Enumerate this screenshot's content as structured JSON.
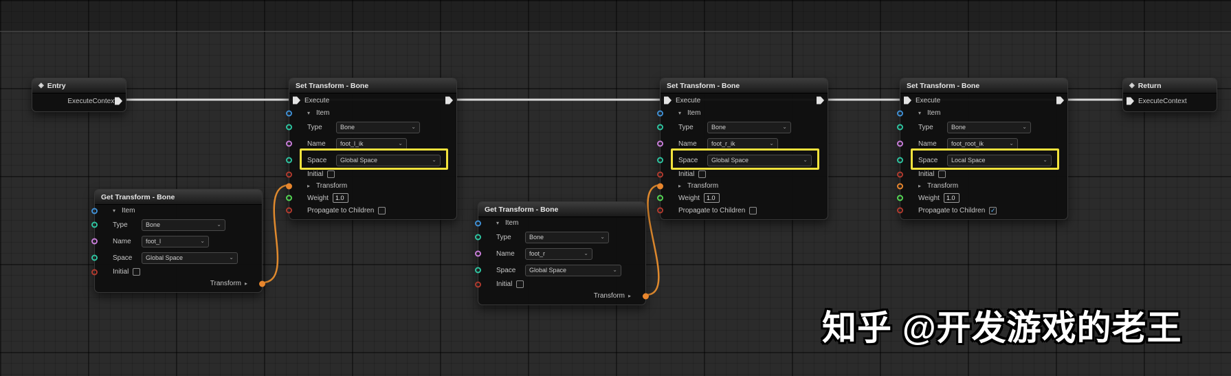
{
  "icons": {
    "diamond": "◈",
    "chevron": "⌄",
    "expander_open": "▾",
    "expander_closed": "▸"
  },
  "labels": {
    "execute": "Execute",
    "item": "Item",
    "type": "Type",
    "name": "Name",
    "space": "Space",
    "initial": "Initial",
    "transform": "Transform",
    "weight": "Weight",
    "propagate": "Propagate to Children"
  },
  "entry": {
    "title": "Entry",
    "pin_label": "ExecuteContext"
  },
  "return": {
    "title": "Return",
    "pin_label": "ExecuteContext"
  },
  "set_nodes": [
    {
      "title": "Set Transform - Bone",
      "type_value": "Bone",
      "name_value": "foot_l_ik",
      "space_value": "Global Space",
      "weight_value": "1.0",
      "propagate_check": ""
    },
    {
      "title": "Set Transform - Bone",
      "type_value": "Bone",
      "name_value": "foot_r_ik",
      "space_value": "Global Space",
      "weight_value": "1.0",
      "propagate_check": ""
    },
    {
      "title": "Set Transform - Bone",
      "type_value": "Bone",
      "name_value": "foot_root_ik",
      "space_value": "Local Space",
      "weight_value": "1.0",
      "propagate_check": "✓"
    }
  ],
  "get_nodes": [
    {
      "title": "Get Transform - Bone",
      "type_value": "Bone",
      "name_value": "foot_l",
      "space_value": "Global Space"
    },
    {
      "title": "Get Transform - Bone",
      "type_value": "Bone",
      "name_value": "foot_r",
      "space_value": "Global Space"
    }
  ],
  "watermark": "知乎 @开发游戏的老王"
}
